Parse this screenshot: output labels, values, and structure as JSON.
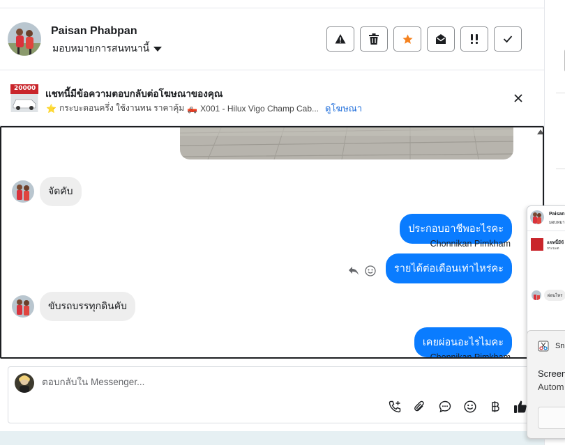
{
  "header": {
    "name": "Paisan Phabpan",
    "assign_label": "มอบหมายการสนทนานี้"
  },
  "actions": [
    {
      "icon": "alert-triangle-icon",
      "name": "spam-button"
    },
    {
      "icon": "trash-icon",
      "name": "delete-button"
    },
    {
      "icon": "star-icon",
      "name": "star-button",
      "color": "#f5821f"
    },
    {
      "icon": "envelope-open-icon",
      "name": "mark-unread-button"
    },
    {
      "icon": "priority-icon",
      "name": "follow-up-button"
    },
    {
      "icon": "check-icon",
      "name": "mark-done-button"
    }
  ],
  "ad": {
    "title": "แชทนี้มีข้อความตอบกลับต่อโฆษณาของคุณ",
    "star": "⭐",
    "subtitle_part1": "กระบะตอนครึ่ง ใช้งานทน ราคาคุ้ม",
    "truck": "🛻",
    "subtitle_part2": "X001 - Hilux Vigo Champ Cab...",
    "link": "ดูโฆษณา",
    "thumb_price": "20000"
  },
  "messages": {
    "in1": "จัดคับ",
    "out1": "ประกอบอาชีพอะไรคะ",
    "sender1": "Chonnikan Pimkham",
    "out2": "รายได้ต่อเดือนเท่าไหร่คะ",
    "in2": "ขับรถบรรทุกดินคับ",
    "out3": "เคยผ่อนอะไรไมคะ",
    "sender2": "Chonnikan Pimkham"
  },
  "composer": {
    "placeholder": "ตอบกลับใน Messenger..."
  },
  "popup": {
    "name": "Paisan",
    "assign": "มอบหมา",
    "ad_title": "แชทนี้มีข้",
    "ad_sub": "กระบะต",
    "msg": "ผ่อนไหร"
  },
  "snip": {
    "title": "Sni",
    "line1": "Screen",
    "line2": "Autom"
  },
  "colors": {
    "accent": "#0a7cff",
    "link": "#216fdb",
    "star": "#f5821f"
  }
}
